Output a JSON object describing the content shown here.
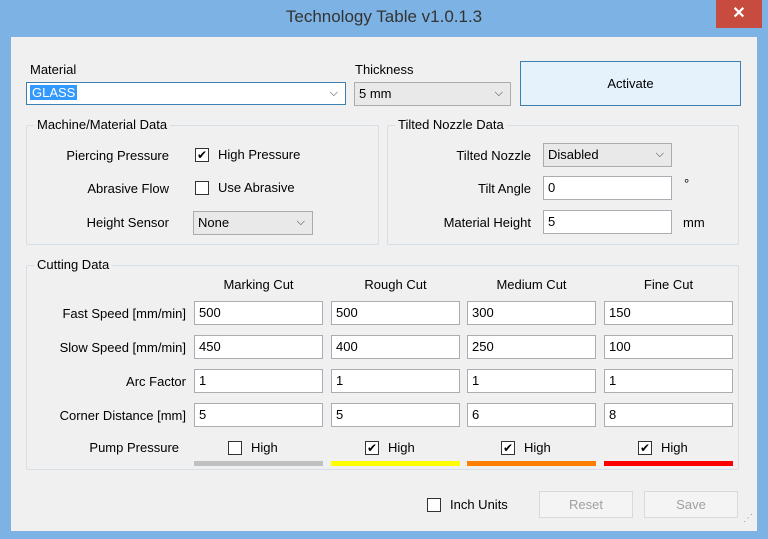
{
  "window": {
    "title": "Technology Table v1.0.1.3",
    "close_glyph": "✕"
  },
  "top": {
    "material_label": "Material",
    "material_value": "GLASS",
    "thickness_label": "Thickness",
    "thickness_value": "5 mm",
    "activate_label": "Activate"
  },
  "machine": {
    "title": "Machine/Material Data",
    "piercing_label": "Piercing Pressure",
    "piercing_cb_label": "High Pressure",
    "piercing_checked": true,
    "abrasive_label": "Abrasive Flow",
    "abrasive_cb_label": "Use Abrasive",
    "abrasive_checked": false,
    "height_label": "Height Sensor",
    "height_value": "None"
  },
  "nozzle": {
    "title": "Tilted Nozzle Data",
    "tilted_label": "Tilted Nozzle",
    "tilted_value": "Disabled",
    "tilt_angle_label": "Tilt Angle",
    "tilt_angle_value": "0",
    "tilt_angle_unit": "°",
    "mat_height_label": "Material Height",
    "mat_height_value": "5",
    "mat_height_unit": "mm"
  },
  "cutting": {
    "title": "Cutting Data",
    "columns": [
      "Marking Cut",
      "Rough Cut",
      "Medium Cut",
      "Fine Cut"
    ],
    "rows": [
      {
        "label": "Fast Speed  [mm/min]",
        "values": [
          "500",
          "500",
          "300",
          "150"
        ]
      },
      {
        "label": "Slow Speed  [mm/min]",
        "values": [
          "450",
          "400",
          "250",
          "100"
        ]
      },
      {
        "label": "Arc Factor",
        "values": [
          "1",
          "1",
          "1",
          "1"
        ]
      },
      {
        "label": "Corner Distance  [mm]",
        "values": [
          "5",
          "5",
          "6",
          "8"
        ]
      }
    ],
    "pump_label": "Pump Pressure",
    "pump": [
      {
        "label": "High",
        "checked": false,
        "color": "#c0c0c0"
      },
      {
        "label": "High",
        "checked": true,
        "color": "#ffff00"
      },
      {
        "label": "High",
        "checked": true,
        "color": "#ff8000"
      },
      {
        "label": "High",
        "checked": true,
        "color": "#ff0000"
      }
    ]
  },
  "footer": {
    "inch_label": "Inch Units",
    "inch_checked": false,
    "reset_label": "Reset",
    "save_label": "Save"
  },
  "icons": {
    "combo": "chevron-down-icon",
    "check": "checkmark-icon",
    "grip": "resize-grip-icon"
  }
}
